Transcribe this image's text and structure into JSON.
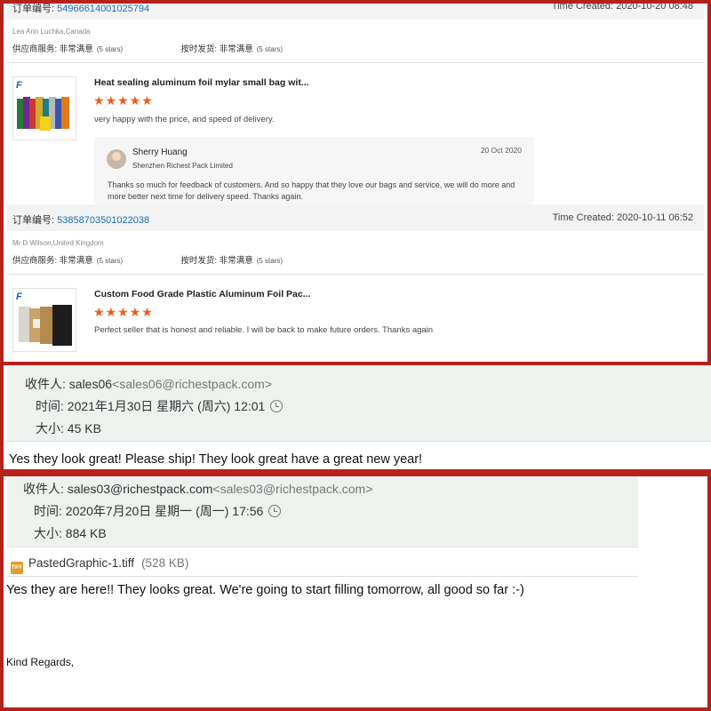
{
  "orders": [
    {
      "order_label": "订单编号:",
      "order_number": "5496661400102579​4",
      "time_label": "Time Created:",
      "time": "2020-10-20 08:48",
      "buyer": "Lea Ann Luchka,Canada",
      "supplier_service_label": "供应商服务:",
      "supplier_service_value": "非常满意",
      "supplier_service_stars": "(5 stars)",
      "ontime_label": "按时发货:",
      "ontime_value": "非常满意",
      "ontime_stars": "(5 stars)",
      "product_title": "Heat sealing aluminum foil mylar small bag wit...",
      "rating_stars": "★★★★★",
      "review": "very happy with the price, and speed of delivery.",
      "reply": {
        "name": "Sherry Huang",
        "company": "Shenzhen Richest Pack Limited",
        "date": "20 Oct 2020",
        "text": "Thanks so much for feedback of customers. And so happy that they love our bags and service, we will do more and more better next  time for delivery speed. Thanks again."
      }
    },
    {
      "order_label": "订单编号:",
      "order_number": "53858703501022038",
      "time_label": "Time Created:",
      "time": "2020-10-11 06:52",
      "buyer": "Mr D Wilson,United Kingdom",
      "supplier_service_label": "供应商服务:",
      "supplier_service_value": "非常满意",
      "supplier_service_stars": "(5 stars)",
      "ontime_label": "按时发货:",
      "ontime_value": "非常满意",
      "ontime_stars": "(5 stars)",
      "product_title": "Custom Food Grade Plastic Aluminum Foil Pac...",
      "rating_stars": "★★★★★",
      "review": "Perfect seller that is honest and reliable. I will be back to make future orders. Thanks again"
    }
  ],
  "emails": [
    {
      "to_label": "收件人:",
      "to_name": "sales06",
      "to_addr": "<sales06@richestpack.com>",
      "time_label": "时间:",
      "time": "2021年1月30日 星期六 (周六) 12:01",
      "size_label": "大小:",
      "size": "45 KB",
      "body": "Yes they look great! Please ship! They look great have a great new year!"
    },
    {
      "to_label": "收件人:",
      "to_name": "sales03@richestpack.com",
      "to_addr": "<sales03@richestpack.com>",
      "time_label": "时间:",
      "time": "2020年7月20日 星期一 (周一) 17:56",
      "size_label": "大小:",
      "size": "884 KB",
      "attachment_name": "PastedGraphic-1.tiff",
      "attachment_size": "(528 KB)",
      "attachment_icon_text": "TIFF",
      "body": "Yes they are here!! They looks great. We're going to start filling tomorrow, all good so far :-)",
      "signoff": "Kind Regards,"
    }
  ],
  "logo_text": "F",
  "colors": {
    "frame": "#b5221b",
    "link": "#1a6fb5",
    "stars": "#f05a1e",
    "email_header": "#edf2ee"
  }
}
